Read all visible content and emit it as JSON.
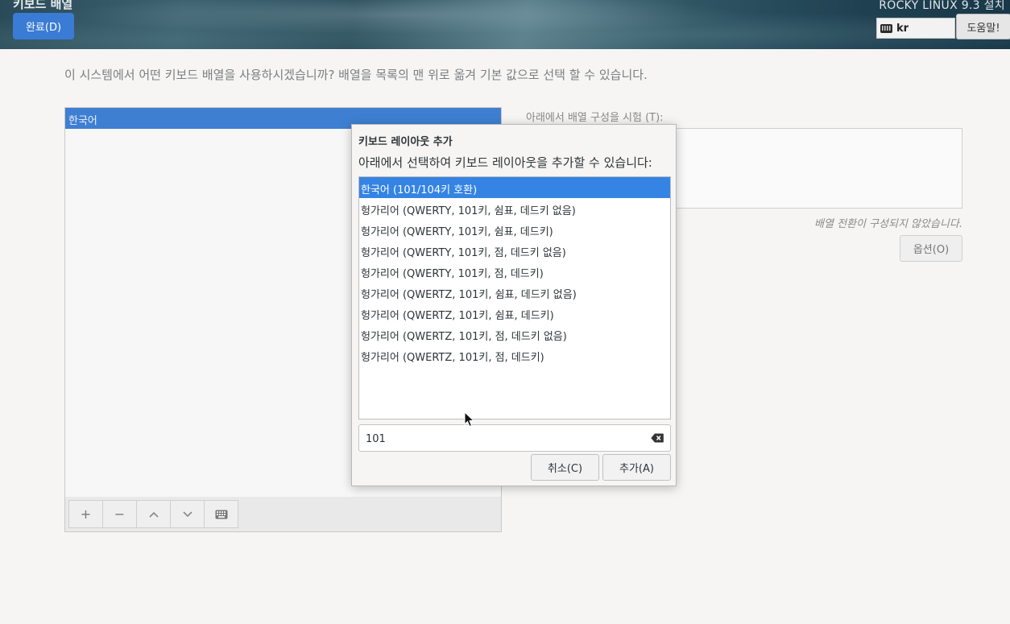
{
  "header": {
    "page_title": "키보드 배열",
    "done_label": "완료(D)",
    "product_title": "ROCKY LINUX 9.3 설치",
    "kb_indicator": "kr",
    "help_label": "도움말!"
  },
  "main": {
    "instruction": "이 시스템에서 어떤 키보드 배열을 사용하시겠습니까? 배열을 목록의 맨 위로 옮겨 기본 값으로 선택 할 수 있습니다.",
    "layouts": [
      "한국어"
    ],
    "toolbar": {
      "add": "+",
      "remove": "−",
      "up": "⌃",
      "down": "⌄"
    },
    "test_label": "아래에서 배열 구성을 시험 (T):",
    "switch_note": "배열 전환이 구성되지 않았습니다.",
    "options_label": "옵션(O)"
  },
  "dialog": {
    "title": "키보드 레이아웃 추가",
    "subtitle": "아래에서 선택하여 키보드 레이아웃을 추가할 수 있습니다:",
    "items": [
      "한국어 (101/104키 호환)",
      "헝가리어 (QWERTY, 101키, 쉼표, 데드키 없음)",
      "헝가리어 (QWERTY, 101키, 쉼표, 데드키)",
      "헝가리어 (QWERTY, 101키, 점, 데드키 없음)",
      "헝가리어 (QWERTY, 101키, 점, 데드키)",
      "헝가리어 (QWERTZ, 101키, 쉼표, 데드키 없음)",
      "헝가리어 (QWERTZ, 101키, 쉼표, 데드키)",
      "헝가리어 (QWERTZ, 101키, 점, 데드키 없음)",
      "헝가리어 (QWERTZ, 101키, 점, 데드키)"
    ],
    "selected_index": 0,
    "search_value": "101",
    "cancel_label": "취소(C)",
    "add_label": "추가(A)"
  },
  "colors": {
    "accent": "#3584e4",
    "done_button": "#3a7bd5"
  }
}
